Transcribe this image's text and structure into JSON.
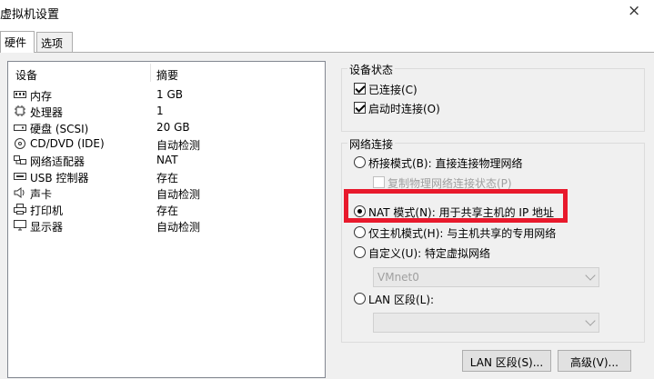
{
  "window": {
    "title": "虚拟机设置",
    "close_glyph": "×"
  },
  "tabs": [
    {
      "label": "硬件",
      "active": true
    },
    {
      "label": "选项",
      "active": false
    }
  ],
  "device_list": {
    "headers": {
      "device": "设备",
      "summary": "摘要"
    },
    "rows": [
      {
        "name": "内存",
        "summary": "1 GB",
        "icon": "memory-icon"
      },
      {
        "name": "处理器",
        "summary": "1",
        "icon": "processor-icon"
      },
      {
        "name": "硬盘 (SCSI)",
        "summary": "20 GB",
        "icon": "hard-disk-icon"
      },
      {
        "name": "CD/DVD (IDE)",
        "summary": "自动检测",
        "icon": "cd-dvd-icon"
      },
      {
        "name": "网络适配器",
        "summary": "NAT",
        "icon": "network-adapter-icon"
      },
      {
        "name": "USB 控制器",
        "summary": "存在",
        "icon": "usb-controller-icon"
      },
      {
        "name": "声卡",
        "summary": "自动检测",
        "icon": "sound-card-icon"
      },
      {
        "name": "打印机",
        "summary": "存在",
        "icon": "printer-icon"
      },
      {
        "name": "显示器",
        "summary": "自动检测",
        "icon": "display-icon"
      }
    ]
  },
  "device_status": {
    "legend": "设备状态",
    "connected": {
      "label": "已连接(C)",
      "checked": true
    },
    "connect_at_power_on": {
      "label": "启动时连接(O)",
      "checked": true
    }
  },
  "network_connection": {
    "legend": "网络连接",
    "bridged": {
      "label": "桥接模式(B): 直接连接物理网络",
      "selected": false
    },
    "replicate_state": {
      "label": "复制物理网络连接状态(P)",
      "checked": false,
      "enabled": false
    },
    "nat": {
      "label": "NAT 模式(N): 用于共享主机的 IP 地址",
      "selected": true
    },
    "host_only": {
      "label": "仅主机模式(H): 与主机共享的专用网络",
      "selected": false
    },
    "custom": {
      "label": "自定义(U): 特定虚拟网络",
      "selected": false
    },
    "custom_network_value": "VMnet0",
    "lan_segment": {
      "label": "LAN 区段(L):",
      "selected": false
    },
    "lan_segment_value": ""
  },
  "buttons": {
    "lan_segments": "LAN 区段(S)...",
    "advanced": "高级(V)..."
  },
  "highlight_color": "#e8192c"
}
